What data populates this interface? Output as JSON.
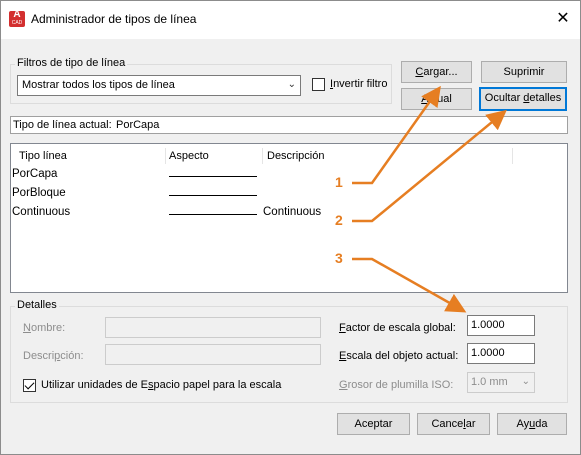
{
  "window": {
    "title": "Administrador de tipos de línea",
    "close_glyph": "✕",
    "app_icon_letter": "A",
    "app_icon_sub": "CAD"
  },
  "filters": {
    "legend": "Filtros de tipo de línea",
    "selected": "Mostrar todos los tipos de línea",
    "invert_label": "Invertir filtro",
    "invert_checked": false
  },
  "buttons": {
    "load": "Cargar...",
    "delete": "Suprimir",
    "current": "Actual",
    "hide_details": "Ocultar detalles",
    "accept": "Aceptar",
    "cancel": "Cancelar",
    "help": "Ayuda"
  },
  "current_linetype": {
    "label": "Tipo de línea actual:",
    "value": "PorCapa"
  },
  "list": {
    "columns": [
      "Tipo línea",
      "Aspecto",
      "Descripción"
    ],
    "rows": [
      {
        "name": "PorCapa",
        "description": ""
      },
      {
        "name": "PorBloque",
        "description": ""
      },
      {
        "name": "Continuous",
        "description": "Continuous"
      }
    ]
  },
  "details": {
    "legend": "Detalles",
    "name_label": "Nombre:",
    "description_label": "Descripción:",
    "paper_space_label": "Utilizar unidades de Espacio papel para la escala",
    "paper_space_checked": true,
    "global_scale_label": "Factor de escala global:",
    "global_scale_value": "1.0000",
    "object_scale_label": "Escala del objeto actual:",
    "object_scale_value": "1.0000",
    "pen_width_label": "Grosor de plumilla ISO:",
    "pen_width_value": "1.0 mm"
  },
  "callouts": [
    "1",
    "2",
    "3"
  ],
  "colors": {
    "callout": "#e67e22",
    "focus_blue": "#0078d7"
  }
}
